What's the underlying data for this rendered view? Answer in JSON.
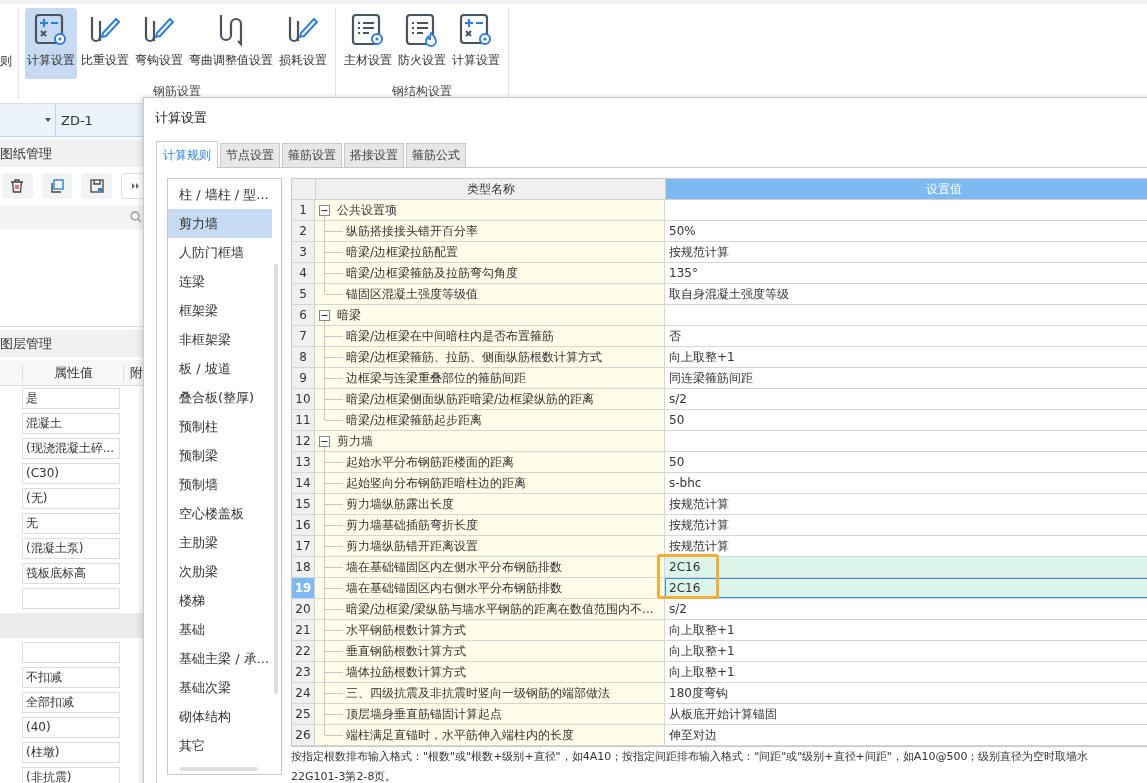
{
  "ribbon": {
    "cut_label": "则",
    "groups": [
      {
        "label": "钢筋设置",
        "buttons": [
          {
            "label": "计算设置",
            "selected": true
          },
          {
            "label": "比重设置",
            "selected": false
          },
          {
            "label": "弯钩设置",
            "selected": false
          },
          {
            "label": "弯曲调整值设置",
            "selected": false
          },
          {
            "label": "损耗设置",
            "selected": false
          }
        ]
      },
      {
        "label": "钢结构设置",
        "buttons": [
          {
            "label": "主材设置",
            "selected": false
          },
          {
            "label": "防火设置",
            "selected": false
          },
          {
            "label": "计算设置",
            "selected": false
          }
        ]
      }
    ]
  },
  "left_panel": {
    "floor_value": "ZD-1",
    "drawing_header": "图纸管理",
    "layer_header": "图层管理",
    "columns": [
      "属性值",
      "附"
    ],
    "properties": [
      {
        "kind": "field",
        "value": "是"
      },
      {
        "kind": "field",
        "value": "混凝土"
      },
      {
        "kind": "field",
        "value": "(现浇混凝土碎..."
      },
      {
        "kind": "field",
        "value": "(C30)"
      },
      {
        "kind": "field",
        "value": "(无)"
      },
      {
        "kind": "field",
        "value": "无"
      },
      {
        "kind": "field",
        "value": "(混凝土泵)"
      },
      {
        "kind": "field",
        "value": "筏板底标高"
      },
      {
        "kind": "field"
      },
      {
        "kind": "band"
      },
      {
        "kind": "field"
      },
      {
        "kind": "field",
        "value": "不扣减"
      },
      {
        "kind": "field",
        "value": "全部扣减"
      },
      {
        "kind": "field",
        "value": "(40)"
      },
      {
        "kind": "field",
        "value": "(柱墩)"
      },
      {
        "kind": "field",
        "value": "(非抗震)"
      }
    ]
  },
  "dialog": {
    "title": "计算设置",
    "tabs": [
      {
        "label": "计算规则",
        "selected": true
      },
      {
        "label": "节点设置",
        "selected": false
      },
      {
        "label": "箍筋设置",
        "selected": false
      },
      {
        "label": "搭接设置",
        "selected": false
      },
      {
        "label": "箍筋公式",
        "selected": false
      }
    ],
    "categories": [
      {
        "label": "柱 / 墙柱 / 型...",
        "selected": false
      },
      {
        "label": "剪力墙",
        "selected": true
      },
      {
        "label": "人防门框墙",
        "selected": false
      },
      {
        "label": "连梁",
        "selected": false
      },
      {
        "label": "框架梁",
        "selected": false
      },
      {
        "label": "非框架梁",
        "selected": false
      },
      {
        "label": "板 / 坡道",
        "selected": false
      },
      {
        "label": "叠合板(整厚)",
        "selected": false
      },
      {
        "label": "预制柱",
        "selected": false
      },
      {
        "label": "预制梁",
        "selected": false
      },
      {
        "label": "预制墙",
        "selected": false
      },
      {
        "label": "空心楼盖板",
        "selected": false
      },
      {
        "label": "主肋梁",
        "selected": false
      },
      {
        "label": "次肋梁",
        "selected": false
      },
      {
        "label": "楼梯",
        "selected": false
      },
      {
        "label": "基础",
        "selected": false
      },
      {
        "label": "基础主梁 / 承...",
        "selected": false
      },
      {
        "label": "基础次梁",
        "selected": false
      },
      {
        "label": "砌体结构",
        "selected": false
      },
      {
        "label": "其它",
        "selected": false
      }
    ],
    "table": {
      "columns": [
        "类型名称",
        "设置值"
      ],
      "rows": [
        {
          "num": "1",
          "kind": "group",
          "name": "公共设置项",
          "expanded": true,
          "selected": false,
          "current": false,
          "annotated": false
        },
        {
          "num": "2",
          "kind": "item",
          "name": "纵筋搭接接头错开百分率",
          "value": "50%",
          "selected": false,
          "current": false,
          "annotated": false
        },
        {
          "num": "3",
          "kind": "item",
          "name": "暗梁/边框梁拉筋配置",
          "value": "按规范计算",
          "selected": false,
          "current": false,
          "annotated": false
        },
        {
          "num": "4",
          "kind": "item",
          "name": "暗梁/边框梁箍筋及拉筋弯勾角度",
          "value": "135°",
          "selected": false,
          "current": false,
          "annotated": false
        },
        {
          "num": "5",
          "kind": "item",
          "name": "锚固区混凝土强度等级值",
          "value": "取自身混凝土强度等级",
          "selected": false,
          "current": false,
          "annotated": false
        },
        {
          "num": "6",
          "kind": "group",
          "name": "暗梁",
          "expanded": true,
          "selected": false,
          "current": false,
          "annotated": false
        },
        {
          "num": "7",
          "kind": "item",
          "name": "暗梁/边框梁在中间暗柱内是否布置箍筋",
          "value": "否",
          "selected": false,
          "current": false,
          "annotated": false
        },
        {
          "num": "8",
          "kind": "item",
          "name": "暗梁/边框梁箍筋、拉筋、侧面纵筋根数计算方式",
          "value": "向上取整+1",
          "selected": false,
          "current": false,
          "annotated": false
        },
        {
          "num": "9",
          "kind": "item",
          "name": "边框梁与连梁重叠部位的箍筋间距",
          "value": "同连梁箍筋间距",
          "selected": false,
          "current": false,
          "annotated": false
        },
        {
          "num": "10",
          "kind": "item",
          "name": "暗梁/边框梁侧面纵筋距暗梁/边框梁纵筋的距离",
          "value": "s/2",
          "selected": false,
          "current": false,
          "annotated": false
        },
        {
          "num": "11",
          "kind": "item",
          "name": "暗梁/边框梁箍筋起步距离",
          "value": "50",
          "selected": false,
          "current": false,
          "annotated": false
        },
        {
          "num": "12",
          "kind": "group",
          "name": "剪力墙",
          "expanded": true,
          "selected": false,
          "current": false,
          "annotated": false
        },
        {
          "num": "13",
          "kind": "item",
          "name": "起始水平分布钢筋距楼面的距离",
          "value": "50",
          "selected": false,
          "current": false,
          "annotated": false
        },
        {
          "num": "14",
          "kind": "item",
          "name": "起始竖向分布钢筋距暗柱边的距离",
          "value": "s-bhc",
          "selected": false,
          "current": false,
          "annotated": false
        },
        {
          "num": "15",
          "kind": "item",
          "name": "剪力墙纵筋露出长度",
          "value": "按规范计算",
          "selected": false,
          "current": false,
          "annotated": false
        },
        {
          "num": "16",
          "kind": "item",
          "name": "剪力墙基础插筋弯折长度",
          "value": "按规范计算",
          "selected": false,
          "current": false,
          "annotated": false
        },
        {
          "num": "17",
          "kind": "item",
          "name": "剪力墙纵筋错开距离设置",
          "value": "按规范计算",
          "selected": false,
          "current": false,
          "annotated": false
        },
        {
          "num": "18",
          "kind": "item",
          "name": "墙在基础锚固区内左侧水平分布钢筋排数",
          "value": "2C16",
          "selected": true,
          "current": false,
          "annotated": true
        },
        {
          "num": "19",
          "kind": "item",
          "name": "墙在基础锚固区内右侧水平分布钢筋排数",
          "value": "2C16",
          "selected": true,
          "current": true,
          "annotated": true
        },
        {
          "num": "20",
          "kind": "item",
          "name": "暗梁/边框梁/梁纵筋与墙水平钢筋的距离在数值范围内不...",
          "value": "s/2",
          "selected": false,
          "current": false,
          "annotated": false
        },
        {
          "num": "21",
          "kind": "item",
          "name": "水平钢筋根数计算方式",
          "value": "向上取整+1",
          "selected": false,
          "current": false,
          "annotated": false
        },
        {
          "num": "22",
          "kind": "item",
          "name": "垂直钢筋根数计算方式",
          "value": "向上取整+1",
          "selected": false,
          "current": false,
          "annotated": false
        },
        {
          "num": "23",
          "kind": "item",
          "name": "墙体拉筋根数计算方式",
          "value": "向上取整+1",
          "selected": false,
          "current": false,
          "annotated": false
        },
        {
          "num": "24",
          "kind": "item",
          "name": "三、四级抗震及非抗震时竖向一级钢筋的端部做法",
          "value": "180度弯钩",
          "selected": false,
          "current": false,
          "annotated": false
        },
        {
          "num": "25",
          "kind": "item",
          "name": "顶层墙身垂直筋锚固计算起点",
          "value": "从板底开始计算锚固",
          "selected": false,
          "current": false,
          "annotated": false
        },
        {
          "num": "26",
          "kind": "item",
          "name": "端柱满足直锚时，水平筋伸入端柱内的长度",
          "value": "伸至对边",
          "selected": false,
          "current": false,
          "annotated": false
        }
      ]
    },
    "note": [
      "按指定根数排布输入格式：\"根数\"或\"根数+级别+直径\"，如4A10；按指定间距排布输入格式：\"间距\"或\"级别+直径+间距\"，如A10@500；级别直径为空时取墙水",
      "22G101-3第2-8页。"
    ]
  }
}
